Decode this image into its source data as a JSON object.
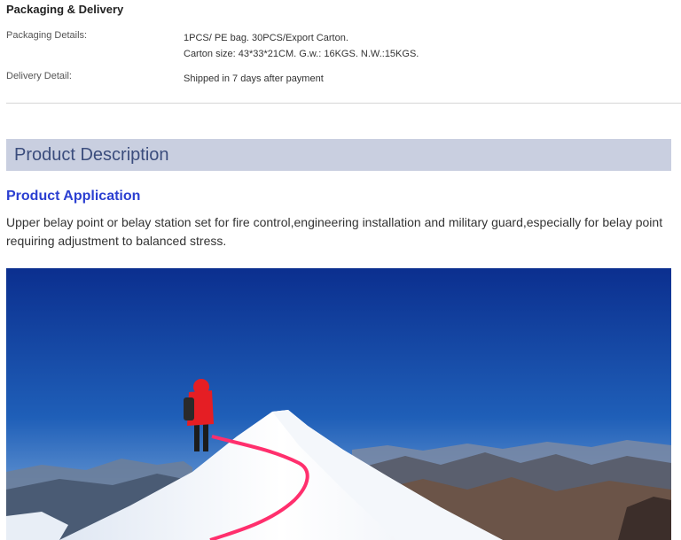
{
  "packaging": {
    "title": "Packaging & Delivery",
    "packaging_details_label": "Packaging Details:",
    "packaging_details_line1": "1PCS/ PE bag. 30PCS/Export Carton.",
    "packaging_details_line2": "Carton size: 43*33*21CM. G.w.: 16KGS. N.W.:15KGS.",
    "delivery_detail_label": "Delivery Detail:",
    "delivery_detail_value": "Shipped in 7 days after payment"
  },
  "description": {
    "header": "Product Description",
    "application_title": "Product Application",
    "application_body": "Upper belay point or belay station set for fire control,engineering installation and military guard,especially for belay point requiring adjustment to balanced stress."
  },
  "colors": {
    "header_bg": "#c9cfe0",
    "header_text": "#3b4d7d",
    "application_title": "#2b3fd1"
  }
}
